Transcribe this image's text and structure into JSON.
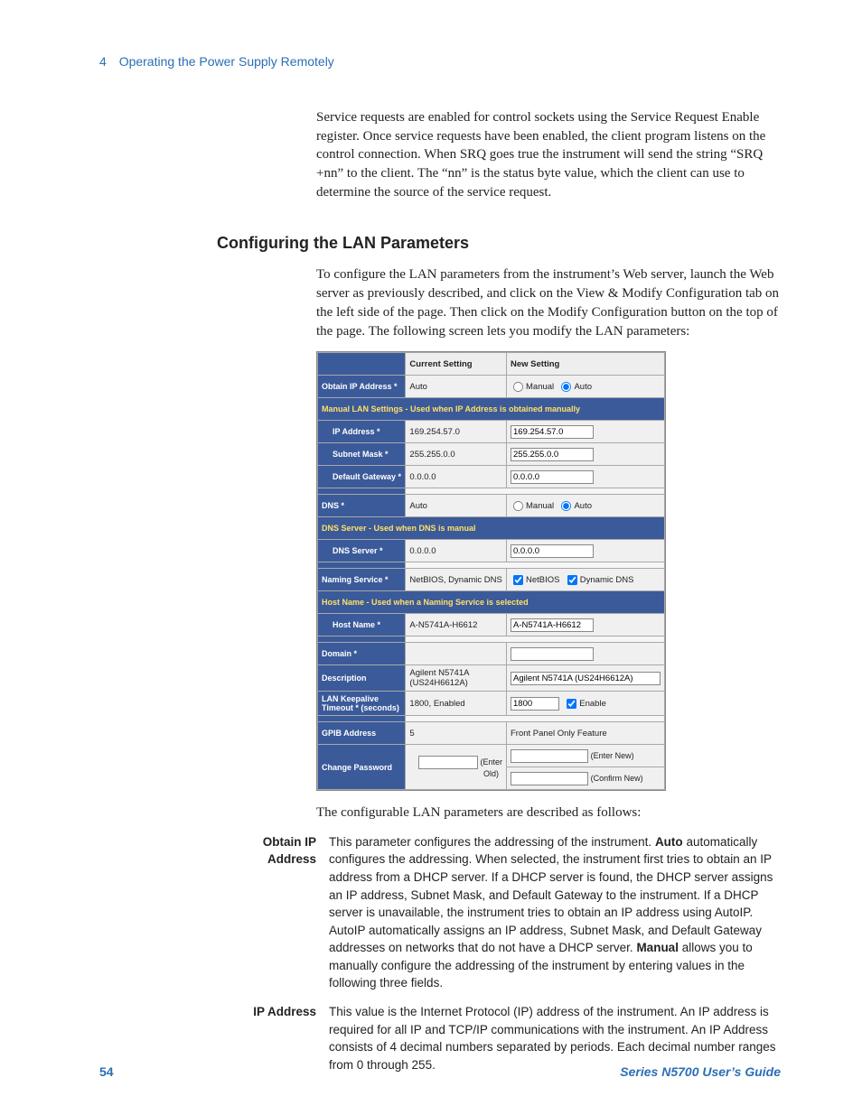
{
  "header": {
    "chapter_number": "4",
    "chapter_title": "Operating the Power Supply Remotely"
  },
  "para1": "Service requests are enabled for control sockets using the Service Request Enable register. Once service requests have been enabled, the client program listens on the control connection. When SRQ goes true the instrument will send the string “SRQ +nn” to the client. The “nn” is the status byte value, which the client can use to determine the source of the service request.",
  "section_heading": "Configuring the LAN Parameters",
  "para2": "To configure the LAN parameters from the instrument’s Web server, launch the Web server as previously described, and click on the View & Modify Configuration tab on the left side of the page. Then click on the Modify Configuration button on the top of the page. The following screen lets you modify the LAN parameters:",
  "dialog": {
    "columns": {
      "current": "Current Setting",
      "new": "New Setting"
    },
    "obtain_ip": {
      "label": "Obtain IP Address *",
      "current": "Auto",
      "opt_manual": "Manual",
      "opt_auto": "Auto"
    },
    "manual_lan_hdr": "Manual LAN Settings - Used when IP Address is obtained manually",
    "ip_address": {
      "label": "IP Address *",
      "current": "169.254.57.0",
      "new": "169.254.57.0"
    },
    "subnet_mask": {
      "label": "Subnet Mask *",
      "current": "255.255.0.0",
      "new": "255.255.0.0"
    },
    "default_gw": {
      "label": "Default Gateway *",
      "current": "0.0.0.0",
      "new": "0.0.0.0"
    },
    "dns": {
      "label": "DNS *",
      "current": "Auto",
      "opt_manual": "Manual",
      "opt_auto": "Auto"
    },
    "dns_hdr": "DNS Server - Used when DNS is manual",
    "dns_server": {
      "label": "DNS Server *",
      "current": "0.0.0.0",
      "new": "0.0.0.0"
    },
    "naming": {
      "label": "Naming Service *",
      "current": "NetBIOS, Dynamic DNS",
      "opt_netbios": "NetBIOS",
      "opt_ddns": "Dynamic DNS"
    },
    "hostname_hdr": "Host Name - Used when a Naming Service is selected",
    "hostname": {
      "label": "Host Name *",
      "current": "A-N5741A-H6612",
      "new": "A-N5741A-H6612"
    },
    "domain": {
      "label": "Domain *",
      "current": "",
      "new": ""
    },
    "description": {
      "label": "Description",
      "current": "Agilent N5741A (US24H6612A)",
      "new": "Agilent N5741A (US24H6612A)"
    },
    "keepalive": {
      "label": "LAN Keepalive Timeout * (seconds)",
      "current": "1800, Enabled",
      "new_value": "1800",
      "enable_label": "Enable"
    },
    "gpib": {
      "label": "GPIB Address",
      "current": "5",
      "note": "Front Panel Only Feature"
    },
    "password": {
      "label": "Change Password",
      "enter_old": "(Enter Old)",
      "enter_new": "(Enter New)",
      "confirm_new": "(Confirm New)"
    }
  },
  "followup": "The configurable LAN parameters are described as follows:",
  "defs": {
    "obtain_ip": {
      "term": "Obtain IP Address",
      "desc_pre": "This parameter configures the addressing of the instrument. ",
      "bold_auto": "Auto",
      "desc_mid": " automatically configures the addressing. When selected, the instrument first tries to obtain an IP address from a DHCP server. If a DHCP server is found, the DHCP server assigns an IP address, Subnet Mask, and Default Gateway to the instrument. If a DHCP server is unavailable, the instrument tries to obtain an IP address using AutoIP. AutoIP automatically assigns an IP address, Subnet Mask, and Default Gateway addresses on networks that do not have a DHCP server. ",
      "bold_manual": "Manual",
      "desc_post": " allows you to manually configure the addressing of the instrument by entering values in the following three fields."
    },
    "ip_address": {
      "term": "IP Address",
      "desc": "This value is the Internet Protocol (IP) address of the instrument.  An IP address is required for all IP and TCP/IP communications with the instrument. An IP Address consists of 4 decimal numbers separated by periods. Each decimal number ranges from 0 through 255."
    }
  },
  "footer": {
    "page": "54",
    "title": "Series N5700 User’s Guide"
  }
}
